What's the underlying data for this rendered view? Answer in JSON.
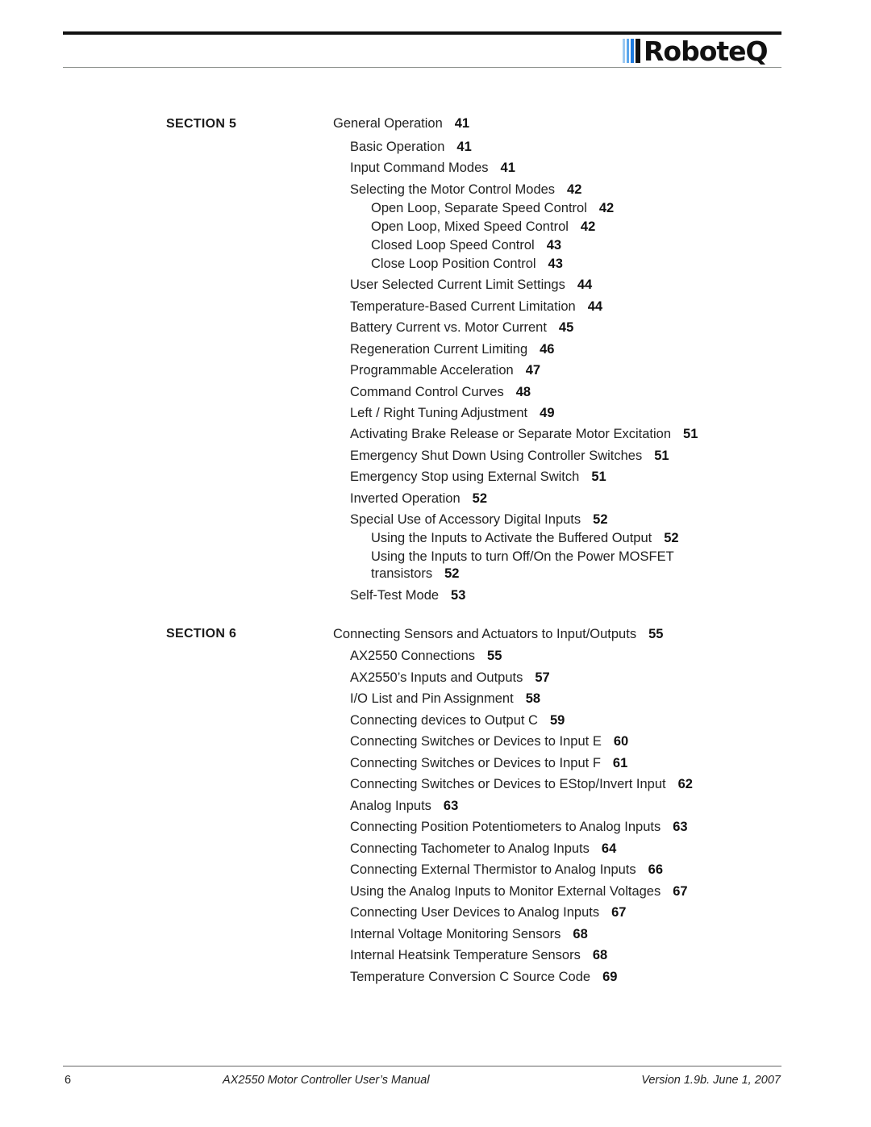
{
  "header": {
    "logo_text": "RoboteQ",
    "logo_bar_colors": [
      "#9cc9f2",
      "#5aa6ec",
      "#1e7be0",
      "#111111"
    ]
  },
  "sections": [
    {
      "label": "SECTION 5",
      "entries": [
        {
          "level": 0,
          "title": "General Operation",
          "page": "41"
        },
        {
          "level": 1,
          "title": "Basic Operation",
          "page": "41"
        },
        {
          "level": 1,
          "title": "Input Command Modes",
          "page": "41"
        },
        {
          "level": 1,
          "title": "Selecting the Motor Control Modes",
          "page": "42"
        },
        {
          "level": 2,
          "title": "Open Loop, Separate Speed Control",
          "page": "42"
        },
        {
          "level": 2,
          "title": "Open Loop, Mixed Speed Control",
          "page": "42"
        },
        {
          "level": 2,
          "title": "Closed Loop Speed Control",
          "page": "43"
        },
        {
          "level": 2,
          "title": "Close Loop Position Control",
          "page": "43"
        },
        {
          "level": 1,
          "title": "User Selected Current Limit Settings",
          "page": "44"
        },
        {
          "level": 1,
          "title": "Temperature-Based Current Limitation",
          "page": "44"
        },
        {
          "level": 1,
          "title": "Battery Current vs. Motor Current",
          "page": "45"
        },
        {
          "level": 1,
          "title": "Regeneration Current Limiting",
          "page": "46"
        },
        {
          "level": 1,
          "title": "Programmable Acceleration",
          "page": "47"
        },
        {
          "level": 1,
          "title": "Command Control Curves",
          "page": "48"
        },
        {
          "level": 1,
          "title": "Left / Right Tuning Adjustment",
          "page": "49"
        },
        {
          "level": 1,
          "title": "Activating Brake Release or Separate Motor Excitation",
          "page": "51"
        },
        {
          "level": 1,
          "title": "Emergency Shut Down Using Controller Switches",
          "page": "51"
        },
        {
          "level": 1,
          "title": "Emergency Stop using External Switch",
          "page": "51"
        },
        {
          "level": 1,
          "title": "Inverted Operation",
          "page": "52"
        },
        {
          "level": 1,
          "title": "Special Use of Accessory Digital Inputs",
          "page": "52"
        },
        {
          "level": 2,
          "title": "Using the Inputs to Activate the Buffered Output",
          "page": "52"
        },
        {
          "level": 2,
          "title": "Using the Inputs to turn Off/On the Power MOSFET",
          "page": ""
        },
        {
          "level": 2,
          "title": "transistors",
          "page": "52"
        },
        {
          "level": 1,
          "title": "Self-Test Mode",
          "page": "53"
        }
      ]
    },
    {
      "label": "SECTION 6",
      "entries": [
        {
          "level": 0,
          "title": "Connecting Sensors and Actuators to Input/Outputs",
          "page": "55"
        },
        {
          "level": 1,
          "title": "AX2550 Connections",
          "page": "55"
        },
        {
          "level": 1,
          "title": "AX2550’s Inputs and Outputs",
          "page": "57"
        },
        {
          "level": 1,
          "title": "I/O List and Pin Assignment",
          "page": "58"
        },
        {
          "level": 1,
          "title": "Connecting devices to Output C",
          "page": "59"
        },
        {
          "level": 1,
          "title": "Connecting Switches or Devices to Input E",
          "page": "60"
        },
        {
          "level": 1,
          "title": "Connecting Switches or Devices to Input F",
          "page": "61"
        },
        {
          "level": 1,
          "title": "Connecting Switches or Devices to EStop/Invert Input",
          "page": "62"
        },
        {
          "level": 1,
          "title": "Analog Inputs",
          "page": "63"
        },
        {
          "level": 1,
          "title": "Connecting Position Potentiometers to Analog Inputs",
          "page": "63"
        },
        {
          "level": 1,
          "title": "Connecting Tachometer to Analog Inputs",
          "page": "64"
        },
        {
          "level": 1,
          "title": "Connecting External Thermistor to Analog Inputs",
          "page": "66"
        },
        {
          "level": 1,
          "title": "Using the Analog Inputs to Monitor External Voltages",
          "page": "67"
        },
        {
          "level": 1,
          "title": "Connecting User Devices to Analog Inputs",
          "page": "67"
        },
        {
          "level": 1,
          "title": "Internal Voltage Monitoring Sensors",
          "page": "68"
        },
        {
          "level": 1,
          "title": "Internal Heatsink Temperature Sensors",
          "page": "68"
        },
        {
          "level": 1,
          "title": "Temperature Conversion C Source Code",
          "page": "69"
        }
      ]
    }
  ],
  "footer": {
    "page_number": "6",
    "manual_title": "AX2550 Motor Controller User’s Manual",
    "version": "Version 1.9b. June 1, 2007"
  }
}
